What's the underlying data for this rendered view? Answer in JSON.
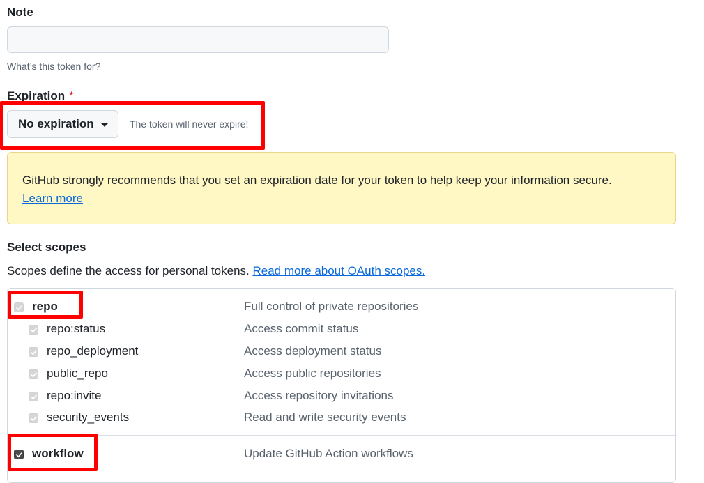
{
  "note": {
    "label": "Note",
    "value": "",
    "placeholder": "",
    "hint": "What’s this token for?"
  },
  "expiration": {
    "label": "Expiration",
    "required_mark": "*",
    "selected": "No expiration",
    "note": "The token will never expire!"
  },
  "warning": {
    "text": "GitHub strongly recommends that you set an expiration date for your token to help keep your information secure.",
    "link": "Learn more"
  },
  "scopes": {
    "title": "Select scopes",
    "description": "Scopes define the access for personal tokens.",
    "link": "Read more about OAuth scopes.",
    "items": [
      {
        "name": "repo",
        "desc": "Full control of private repositories",
        "checked": true,
        "disabled": true
      },
      {
        "name": "repo:status",
        "desc": "Access commit status",
        "checked": true,
        "disabled": true
      },
      {
        "name": "repo_deployment",
        "desc": "Access deployment status",
        "checked": true,
        "disabled": true
      },
      {
        "name": "public_repo",
        "desc": "Access public repositories",
        "checked": true,
        "disabled": true
      },
      {
        "name": "repo:invite",
        "desc": "Access repository invitations",
        "checked": true,
        "disabled": true
      },
      {
        "name": "security_events",
        "desc": "Read and write security events",
        "checked": true,
        "disabled": true
      },
      {
        "name": "workflow",
        "desc": "Update GitHub Action workflows",
        "checked": true,
        "disabled": false
      }
    ]
  },
  "colors": {
    "highlight": "#ff0000",
    "warning_bg": "#fff8c5",
    "link": "#0969da"
  }
}
